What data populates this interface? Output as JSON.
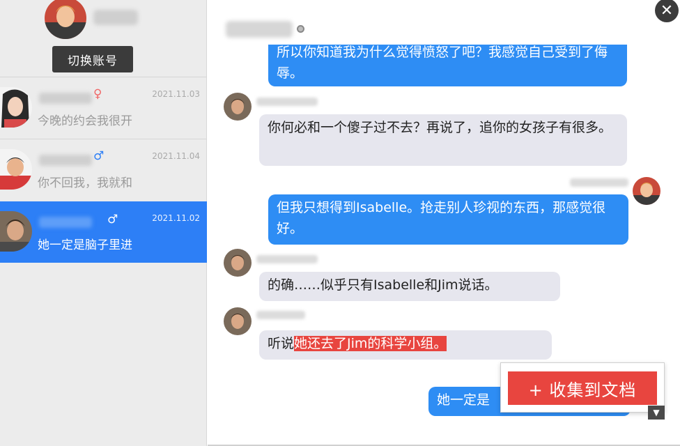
{
  "sidebar": {
    "switch_account": "切换账号",
    "conversations": [
      {
        "gender_symbol": "♀",
        "date": "2021.11.03",
        "preview": "今晚的约会我很开"
      },
      {
        "gender_symbol": "♂",
        "date": "2021.11.04",
        "preview": "你不回我，我就和"
      },
      {
        "gender_symbol": "♂",
        "date": "2021.11.02",
        "preview": "她一定是脑子里进"
      }
    ]
  },
  "chat": {
    "close_icon": "✕",
    "messages": [
      {
        "text": "所以你知道我为什么觉得愤怒了吧？我感觉自己受到了侮辱。"
      },
      {
        "text": "你何必和一个傻子过不去？再说了，追你的女孩子有很多。"
      },
      {
        "text": "但我只想得到Isabelle。抢走别人珍视的东西，那感觉很好。"
      },
      {
        "text": "的确……似乎只有Isabelle和Jim说话。"
      },
      {
        "prefix": "听说",
        "highlight": "她还去了Jim的科学小组。"
      },
      {
        "text": "她一定是"
      }
    ],
    "collect_to_doc": "+ 收集到文档"
  },
  "colors": {
    "accent_blue": "#2d7ff6",
    "highlight_red": "#e8453f",
    "incoming_bubble": "#e6e6ee"
  }
}
